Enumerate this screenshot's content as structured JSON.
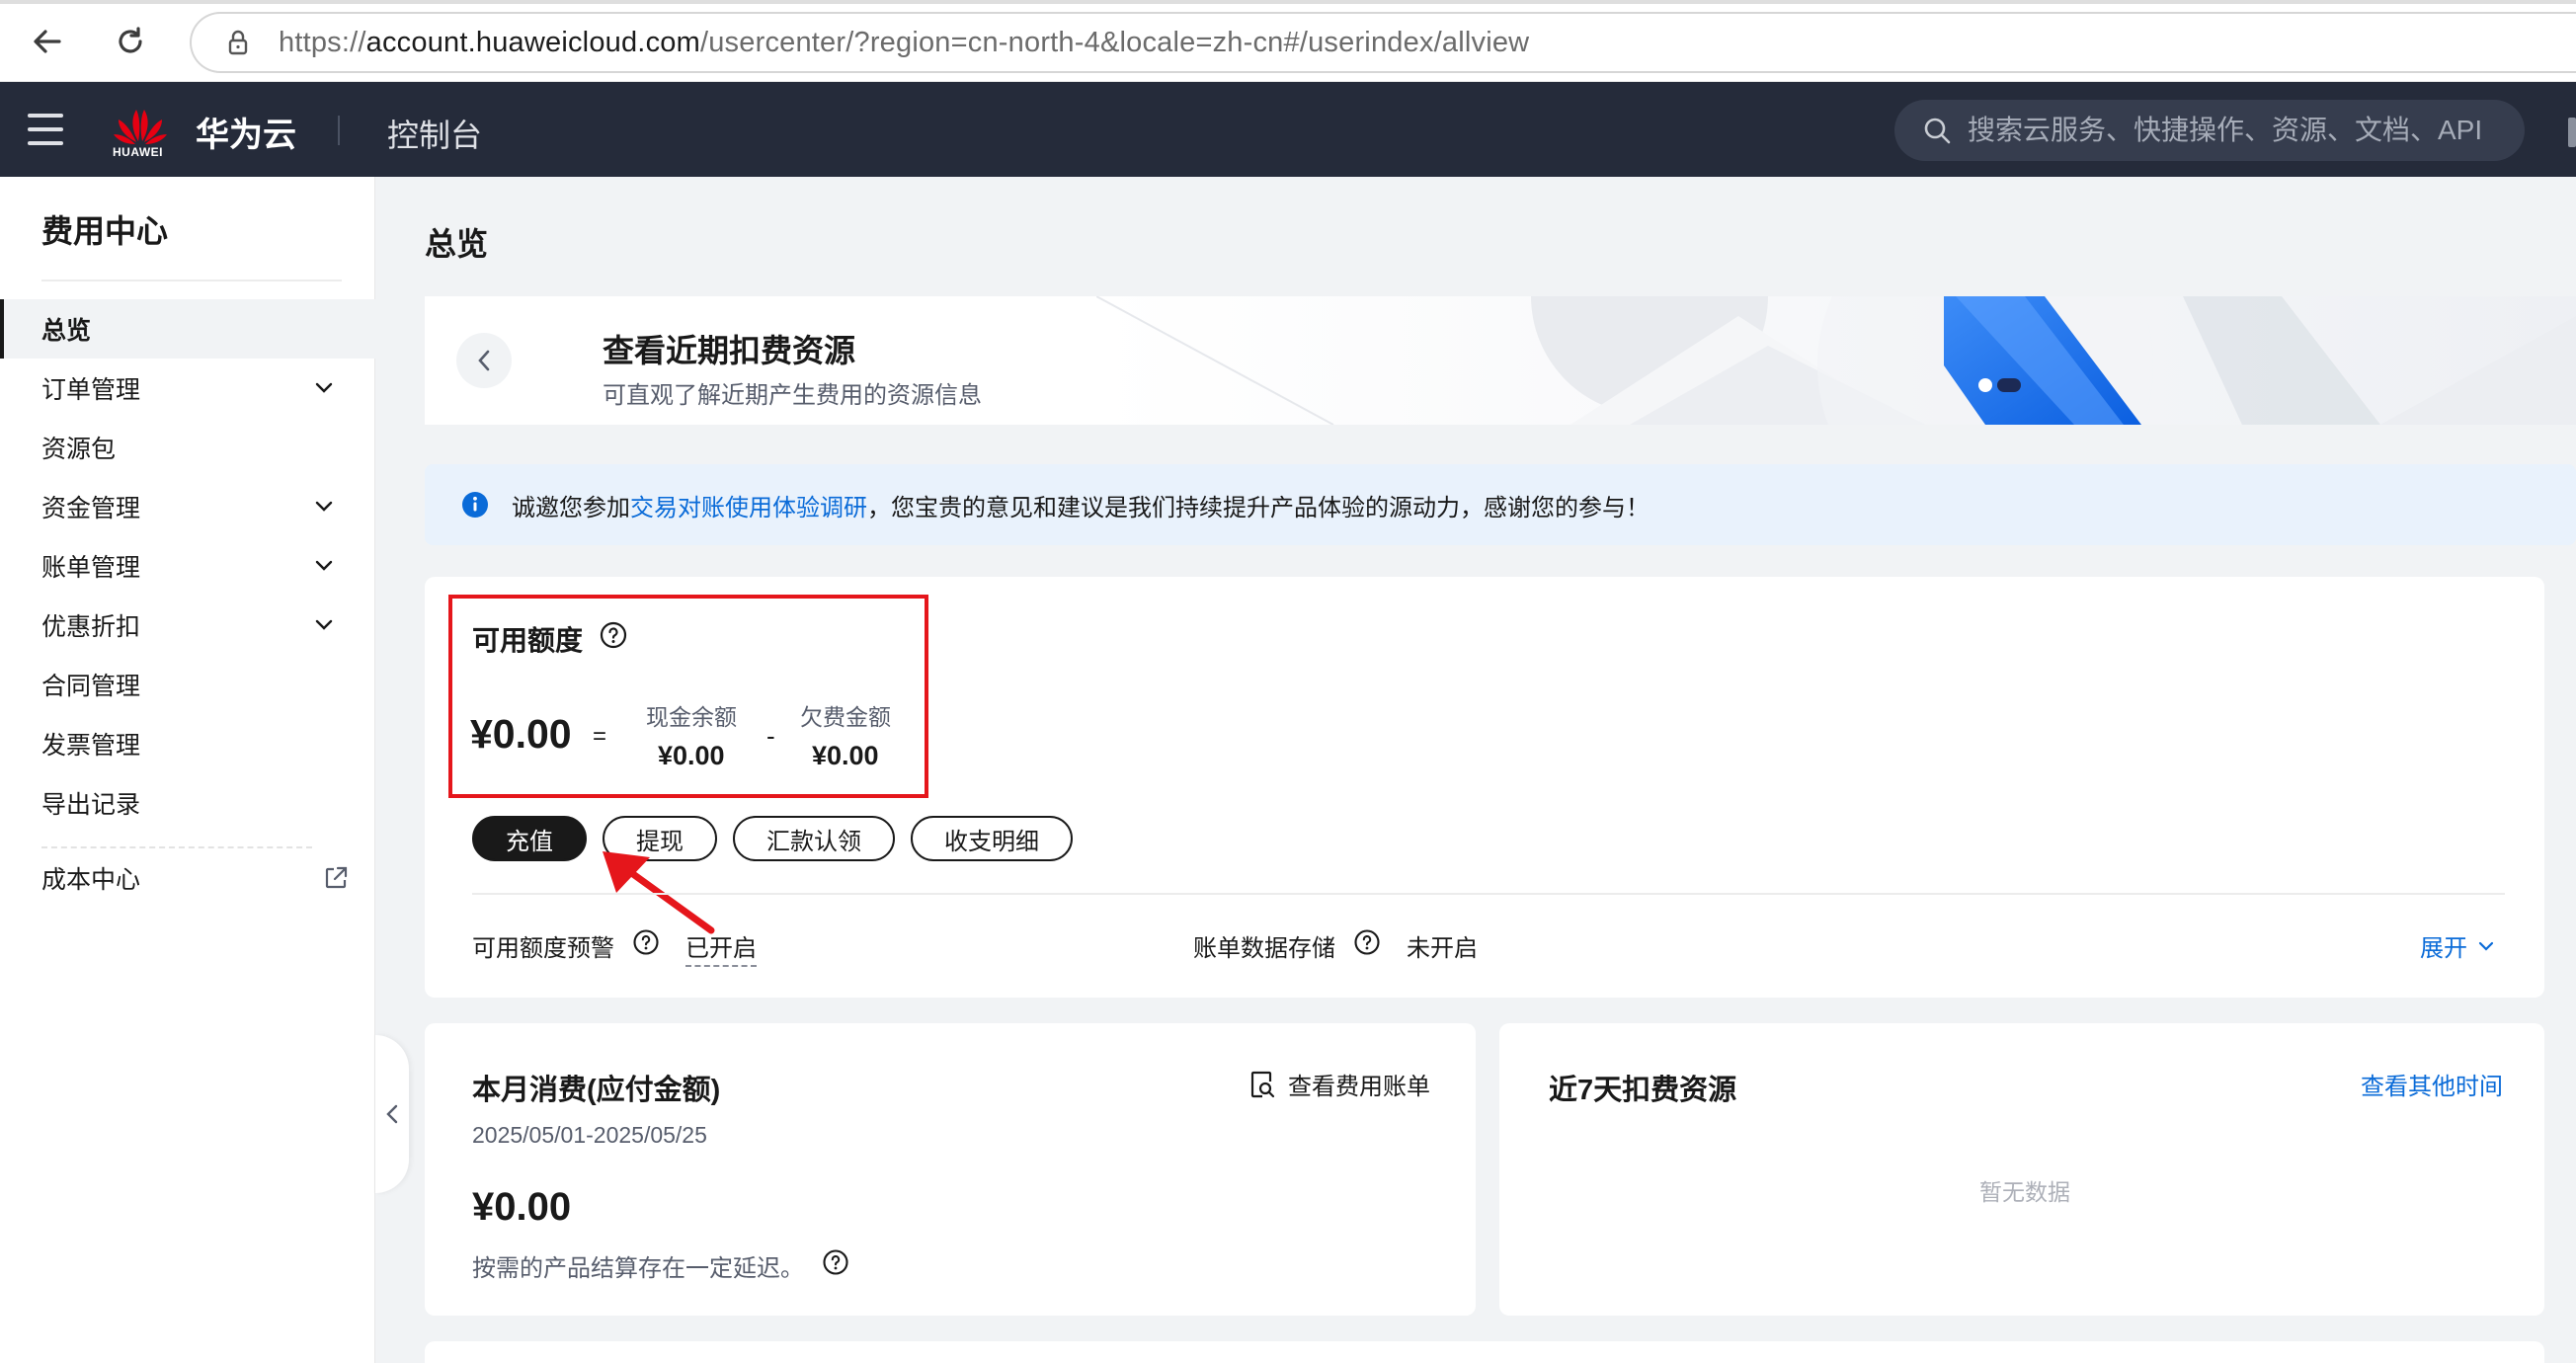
{
  "browser": {
    "url_prefix": "https://",
    "url_host": "account.huaweicloud.com",
    "url_path": "/usercenter/?region=cn-north-4&locale=zh-cn#/userindex/allview"
  },
  "header": {
    "logo_word": "HUAWEI",
    "brand": "华为云",
    "console": "控制台",
    "search_placeholder": "搜索云服务、快捷操作、资源、文档、API"
  },
  "sidebar": {
    "title": "费用中心",
    "items": [
      {
        "label": "总览"
      },
      {
        "label": "订单管理"
      },
      {
        "label": "资源包"
      },
      {
        "label": "资金管理"
      },
      {
        "label": "账单管理"
      },
      {
        "label": "优惠折扣"
      },
      {
        "label": "合同管理"
      },
      {
        "label": "发票管理"
      },
      {
        "label": "导出记录"
      },
      {
        "label": "成本中心"
      }
    ]
  },
  "main": {
    "page_title": "总览",
    "banner": {
      "title": "查看近期扣费资源",
      "subtitle": "可直观了解近期产生费用的资源信息"
    },
    "notice": {
      "before": "诚邀您参加",
      "link": "交易对账使用体验调研",
      "after": "，您宝贵的意见和建议是我们持续提升产品体验的源动力，感谢您的参与！"
    },
    "balance": {
      "label": "可用额度",
      "total": "¥0.00",
      "equals": "=",
      "cash_label": "现金余额",
      "cash": "¥0.00",
      "minus": "-",
      "debt_label": "欠费金额",
      "debt": "¥0.00",
      "buttons": {
        "recharge": "充值",
        "withdraw": "提现",
        "remit_claim": "汇款认领",
        "statement": "收支明细"
      },
      "alert_label": "可用额度预警",
      "alert_value": "已开启",
      "storage_label": "账单数据存储",
      "storage_value": "未开启",
      "expand": "展开"
    },
    "month": {
      "title": "本月消费(应付金额)",
      "bill_link": "查看费用账单",
      "period": "2025/05/01-2025/05/25",
      "amount": "¥0.00",
      "note": "按需的产品结算存在一定延迟。"
    },
    "recent": {
      "title": "近7天扣费资源",
      "link": "查看其他时间",
      "empty": "暂无数据"
    }
  },
  "colors": {
    "header_bg": "#252b3a",
    "link_blue": "#0a6bd8",
    "highlight_red": "#e5161b",
    "notice_bg": "#e9f2fc"
  },
  "icons": [
    "back-arrow-icon",
    "reload-icon",
    "lock-icon",
    "hamburger-icon",
    "huawei-logo-icon",
    "search-icon",
    "chevron-down-icon",
    "external-link-icon",
    "chevron-left-icon",
    "info-icon",
    "help-circle-icon",
    "bill-search-icon"
  ]
}
